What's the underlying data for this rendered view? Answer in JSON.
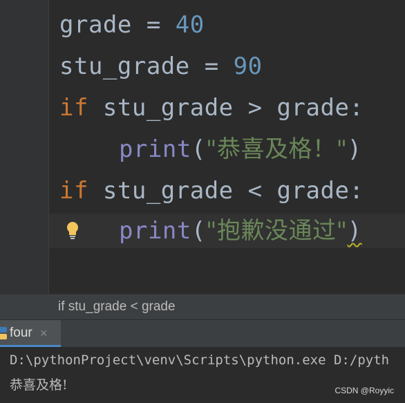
{
  "editor": {
    "lines": {
      "l1": {
        "var": "grade",
        "op": " = ",
        "num": "40"
      },
      "l2": {
        "var": "stu_grade",
        "op": " = ",
        "num": "90"
      },
      "l3": {
        "kw": "if",
        "cond": " stu_grade > grade:"
      },
      "l4": {
        "fn": "print",
        "open": "(",
        "str": "\"恭喜及格！\"",
        "close": ")"
      },
      "l5": {
        "kw": "if",
        "cond": " stu_grade < grade:"
      },
      "l6": {
        "fn": "print",
        "open": "(",
        "str": "\"抱歉没通过\"",
        "close": ")"
      }
    },
    "gutter_icon": "lightbulb-icon"
  },
  "breadcrumb": {
    "text": "if stu_grade < grade"
  },
  "run_panel": {
    "tab_label": "four",
    "tab_close": "×",
    "tab_icon": "python-run-icon",
    "console": {
      "command": "D:\\pythonProject\\venv\\Scripts\\python.exe D:/pyth",
      "output": "恭喜及格!"
    }
  },
  "watermark": "CSDN @Royyic",
  "colors": {
    "background": "#2b2b2b",
    "keyword": "#cc7832",
    "number": "#6897bb",
    "builtin": "#8888c6",
    "string": "#6a8759",
    "text": "#a9b7c6"
  }
}
